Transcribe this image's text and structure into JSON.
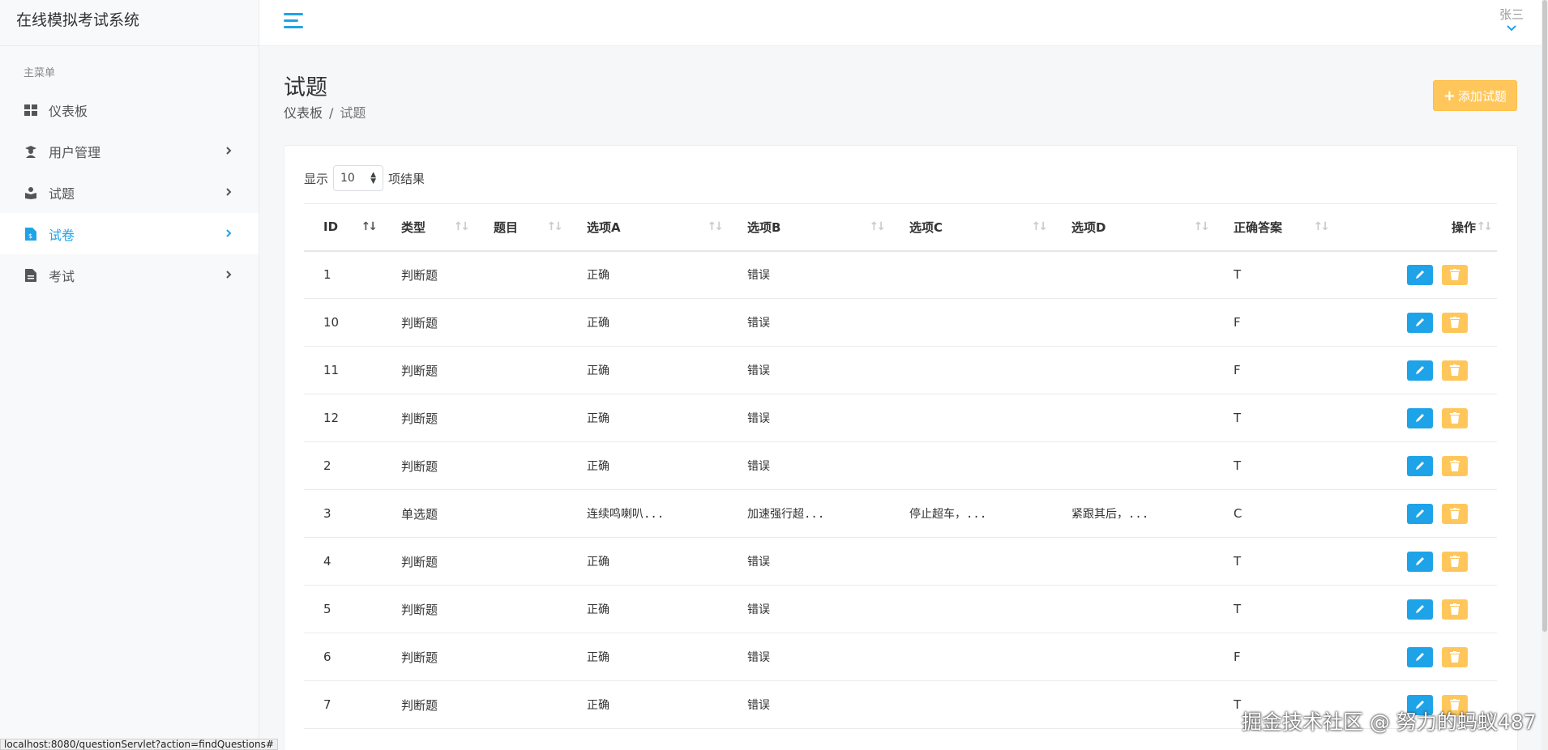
{
  "app": {
    "brand": "在线模拟考试系统"
  },
  "sidebar": {
    "heading": "主菜单",
    "items": [
      {
        "label": "仪表板",
        "icon": "dashboard-icon"
      },
      {
        "label": "用户管理",
        "icon": "user-graduate-icon"
      },
      {
        "label": "试题",
        "icon": "book-reader-icon"
      },
      {
        "label": "试卷",
        "icon": "file-invoice-icon"
      },
      {
        "label": "考试",
        "icon": "file-alt-icon"
      }
    ]
  },
  "topbar": {
    "user_name": "张三"
  },
  "page": {
    "title": "试题",
    "breadcrumb": [
      "仪表板",
      "试题"
    ],
    "add_button": "添加试题"
  },
  "table_controls": {
    "show_prefix": "显示",
    "page_length": "10",
    "show_suffix": "项结果"
  },
  "table": {
    "columns": [
      "ID",
      "类型",
      "题目",
      "选项A",
      "选项B",
      "选项C",
      "选项D",
      "正确答案",
      "操作"
    ],
    "rows": [
      {
        "id": "1",
        "type": "判断题",
        "question": "",
        "a": "正确",
        "b": "错误",
        "c": "",
        "d": "",
        "answer": "T"
      },
      {
        "id": "10",
        "type": "判断题",
        "question": "",
        "a": "正确",
        "b": "错误",
        "c": "",
        "d": "",
        "answer": "F"
      },
      {
        "id": "11",
        "type": "判断题",
        "question": "",
        "a": "正确",
        "b": "错误",
        "c": "",
        "d": "",
        "answer": "F"
      },
      {
        "id": "12",
        "type": "判断题",
        "question": "",
        "a": "正确",
        "b": "错误",
        "c": "",
        "d": "",
        "answer": "T"
      },
      {
        "id": "2",
        "type": "判断题",
        "question": "",
        "a": "正确",
        "b": "错误",
        "c": "",
        "d": "",
        "answer": "T"
      },
      {
        "id": "3",
        "type": "单选题",
        "question": "",
        "a": "连续鸣喇叭...",
        "b": "加速强行超...",
        "c": "停止超车，...",
        "d": "紧跟其后，...",
        "answer": "C"
      },
      {
        "id": "4",
        "type": "判断题",
        "question": "",
        "a": "正确",
        "b": "错误",
        "c": "",
        "d": "",
        "answer": "T"
      },
      {
        "id": "5",
        "type": "判断题",
        "question": "",
        "a": "正确",
        "b": "错误",
        "c": "",
        "d": "",
        "answer": "T"
      },
      {
        "id": "6",
        "type": "判断题",
        "question": "",
        "a": "正确",
        "b": "错误",
        "c": "",
        "d": "",
        "answer": "F"
      },
      {
        "id": "7",
        "type": "判断题",
        "question": "",
        "a": "正确",
        "b": "错误",
        "c": "",
        "d": "",
        "answer": "T"
      }
    ]
  },
  "status_url": "localhost:8080/questionServlet?action=findQuestions#",
  "watermark": "掘金技术社区 @ 努力的蚂蚁487",
  "colors": {
    "accent": "#1fa3e8",
    "warning": "#ffc75b"
  }
}
